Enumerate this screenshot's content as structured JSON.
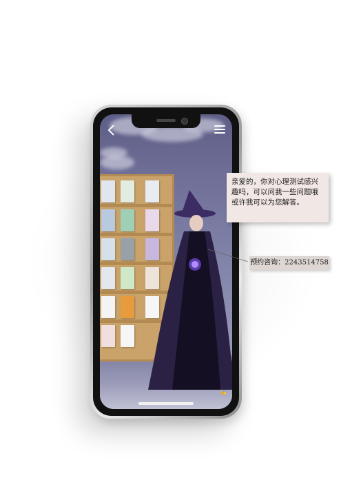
{
  "icons": {
    "back": "chevron-left-icon",
    "menu": "hamburger-menu-icon"
  },
  "speech_bubble": {
    "text": "亲爱的，你对心理测试感兴趣吗，可以问我一些问题哦 或许我可以为您解答。"
  },
  "contact": {
    "label": "预约咨询：2243514758"
  },
  "colors": {
    "bubble_bg": "#f1e7e5",
    "contact_bg": "#ded6d2",
    "sky": "#6e6e97",
    "shelf": "#c9a36a",
    "cloak": "#2b2145"
  }
}
